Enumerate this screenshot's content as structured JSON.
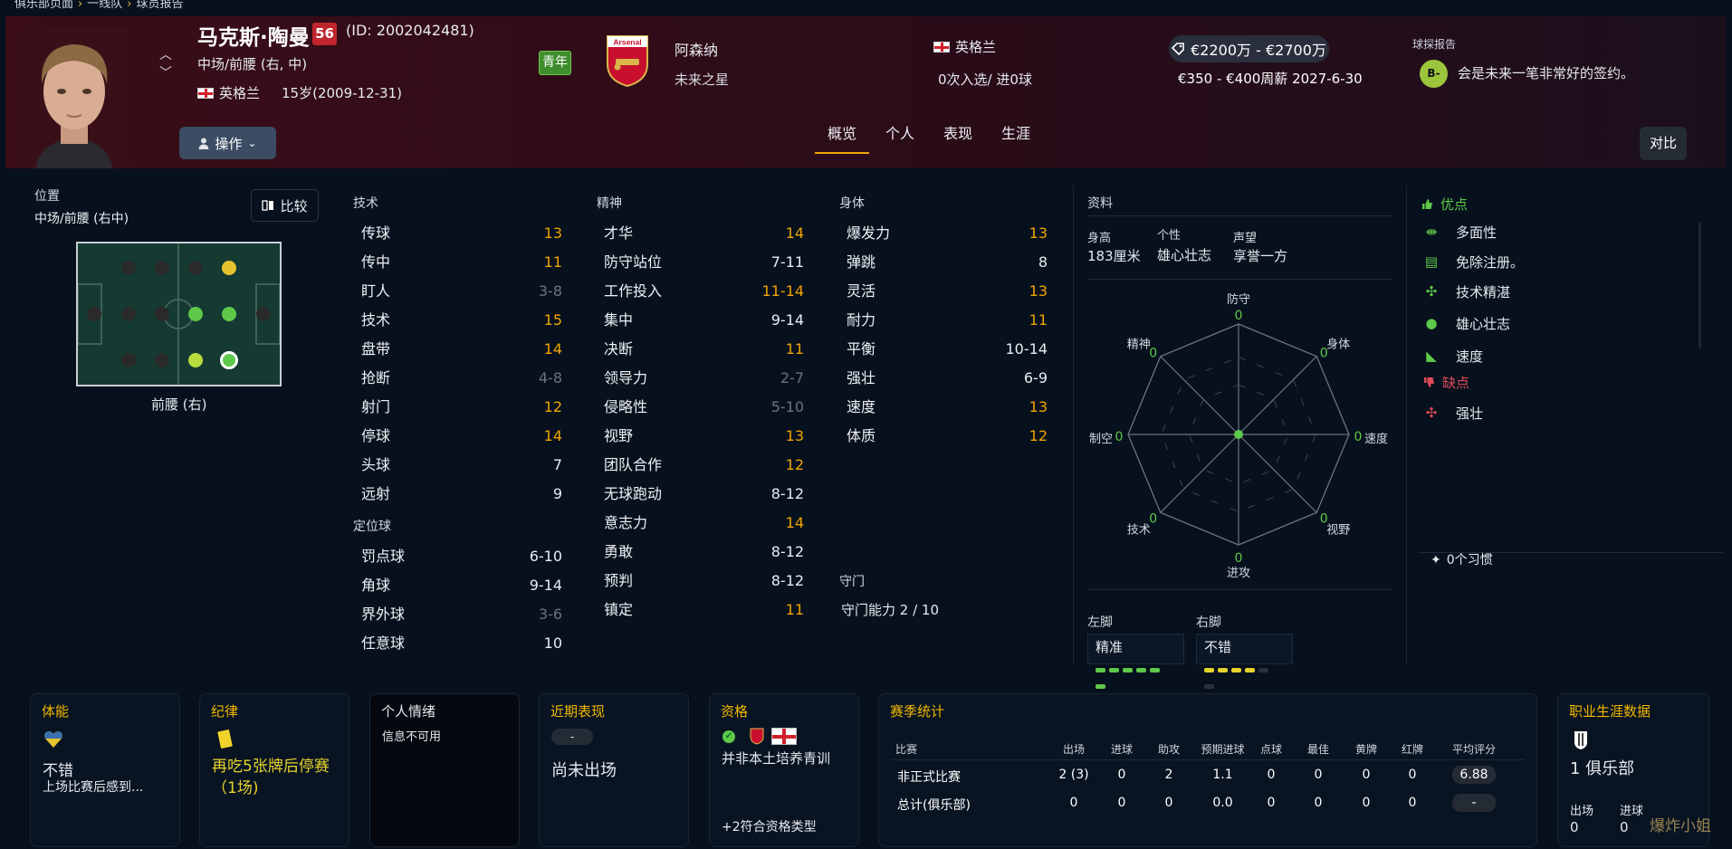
{
  "breadcrumb": [
    "俱乐部页面",
    "一线队",
    "球员报告"
  ],
  "player": {
    "name": "马克斯·陶曼",
    "ovr": "56",
    "id": "(ID: 2002042481)",
    "position": "中场/前腰 (右, 中)",
    "nation": "英格兰",
    "age": "15岁(2009-12-31)",
    "youth_tag": "青年",
    "action_btn": "操作"
  },
  "club": {
    "name": "阿森纳",
    "crest_text": "Arsenal",
    "status": "未来之星"
  },
  "intl": {
    "nation": "英格兰",
    "caps": "0次入选/ 进0球"
  },
  "finance": {
    "value": "€2200万 - €2700万",
    "contract": "€350 - €400周薪  2027-6-30"
  },
  "scout": {
    "label": "球探报告",
    "grade": "B-",
    "text": "会是未来一笔非常好的签约。"
  },
  "tabs": [
    "概览",
    "个人",
    "表现",
    "生涯"
  ],
  "compare_label": "对比",
  "position_panel": {
    "title": "位置",
    "value": "中场/前腰 (右中)",
    "compare_btn": "比较",
    "current": "前腰 (右)"
  },
  "technical": {
    "title": "技术",
    "items": [
      {
        "n": "传球",
        "v": "13",
        "c": "#f0a500"
      },
      {
        "n": "传中",
        "v": "11",
        "c": "#f0a500"
      },
      {
        "n": "盯人",
        "v": "3-8",
        "c": "#6b7380"
      },
      {
        "n": "技术",
        "v": "15",
        "c": "#f0a500"
      },
      {
        "n": "盘带",
        "v": "14",
        "c": "#f0a500"
      },
      {
        "n": "抢断",
        "v": "4-8",
        "c": "#6b7380"
      },
      {
        "n": "射门",
        "v": "12",
        "c": "#f0a500"
      },
      {
        "n": "停球",
        "v": "14",
        "c": "#f0a500"
      },
      {
        "n": "头球",
        "v": "7",
        "c": "#e8ecf2"
      },
      {
        "n": "远射",
        "v": "9",
        "c": "#e8ecf2"
      }
    ]
  },
  "setpieces": {
    "title": "定位球",
    "items": [
      {
        "n": "罚点球",
        "v": "6-10",
        "c": "#e8ecf2"
      },
      {
        "n": "角球",
        "v": "9-14",
        "c": "#e8ecf2"
      },
      {
        "n": "界外球",
        "v": "3-6",
        "c": "#6b7380"
      },
      {
        "n": "任意球",
        "v": "10",
        "c": "#e8ecf2"
      }
    ]
  },
  "mental": {
    "title": "精神",
    "items": [
      {
        "n": "才华",
        "v": "14",
        "c": "#f0a500"
      },
      {
        "n": "防守站位",
        "v": "7-11",
        "c": "#e8ecf2"
      },
      {
        "n": "工作投入",
        "v": "11-14",
        "c": "#f0a500"
      },
      {
        "n": "集中",
        "v": "9-14",
        "c": "#e8ecf2"
      },
      {
        "n": "决断",
        "v": "11",
        "c": "#f0a500"
      },
      {
        "n": "领导力",
        "v": "2-7",
        "c": "#6b7380"
      },
      {
        "n": "侵略性",
        "v": "5-10",
        "c": "#6b7380"
      },
      {
        "n": "视野",
        "v": "13",
        "c": "#f0a500"
      },
      {
        "n": "团队合作",
        "v": "12",
        "c": "#f0a500"
      },
      {
        "n": "无球跑动",
        "v": "8-12",
        "c": "#e8ecf2"
      },
      {
        "n": "意志力",
        "v": "14",
        "c": "#f0a500"
      },
      {
        "n": "勇敢",
        "v": "8-12",
        "c": "#e8ecf2"
      },
      {
        "n": "预判",
        "v": "8-12",
        "c": "#e8ecf2"
      },
      {
        "n": "镇定",
        "v": "11",
        "c": "#f0a500"
      }
    ]
  },
  "physical": {
    "title": "身体",
    "items": [
      {
        "n": "爆发力",
        "v": "13",
        "c": "#f0a500"
      },
      {
        "n": "弹跳",
        "v": "8",
        "c": "#e8ecf2"
      },
      {
        "n": "灵活",
        "v": "13",
        "c": "#f0a500"
      },
      {
        "n": "耐力",
        "v": "11",
        "c": "#f0a500"
      },
      {
        "n": "平衡",
        "v": "10-14",
        "c": "#e8ecf2"
      },
      {
        "n": "强壮",
        "v": "6-9",
        "c": "#e8ecf2"
      },
      {
        "n": "速度",
        "v": "13",
        "c": "#f0a500"
      },
      {
        "n": "体质",
        "v": "12",
        "c": "#f0a500"
      }
    ]
  },
  "gk": {
    "title": "守门",
    "ability": "守门能力 2 / 10"
  },
  "profile": {
    "title": "资料",
    "height_lbl": "身高",
    "height": "183厘米",
    "pers_lbl": "个性",
    "pers": "雄心壮志",
    "rep_lbl": "声望",
    "rep": "享誉一方"
  },
  "radar": {
    "labels": [
      "防守",
      "身体",
      "速度",
      "视野",
      "进攻",
      "技术",
      "制空",
      "精神"
    ],
    "values": [
      0,
      0,
      0,
      0,
      0,
      0,
      0,
      0
    ]
  },
  "feet": {
    "left_lbl": "左脚",
    "left": "精准",
    "right_lbl": "右脚",
    "right": "不错"
  },
  "strengths": {
    "title": "优点",
    "items": [
      "多面性",
      "免除注册。",
      "技术精湛",
      "雄心壮志",
      "速度"
    ]
  },
  "weaknesses": {
    "title": "缺点",
    "items": [
      "强壮"
    ]
  },
  "habits": "0个习惯",
  "bottom": {
    "fitness": {
      "title": "体能",
      "status": "不错",
      "note": "上场比赛后感到..."
    },
    "discipline": {
      "title": "纪律",
      "text": "再吃5张牌后停赛（1场)"
    },
    "mood": {
      "title": "个人情绪",
      "text": "信息不可用"
    },
    "form": {
      "title": "近期表现",
      "pill": "-",
      "text": "尚未出场"
    },
    "eligibility": {
      "title": "资格",
      "text": "并非本土培养青训",
      "more": "+2符合资格类型"
    },
    "season": {
      "title": "赛季统计",
      "headers": [
        "比赛",
        "出场",
        "进球",
        "助攻",
        "预期进球",
        "点球",
        "最佳",
        "黄牌",
        "红牌",
        "平均评分"
      ],
      "rows": [
        [
          "非正式比赛",
          "2 (3)",
          "0",
          "2",
          "1.1",
          "0",
          "0",
          "0",
          "0",
          "6.88"
        ],
        [
          "总计(俱乐部)",
          "0",
          "0",
          "0",
          "0.0",
          "0",
          "0",
          "0",
          "0",
          "-"
        ]
      ]
    },
    "career": {
      "title": "职业生涯数据",
      "clubs": "1 俱乐部",
      "apps_lbl": "出场",
      "apps": "0",
      "goals_lbl": "进球",
      "goals": "0"
    }
  },
  "watermark": "爆炸小姐"
}
